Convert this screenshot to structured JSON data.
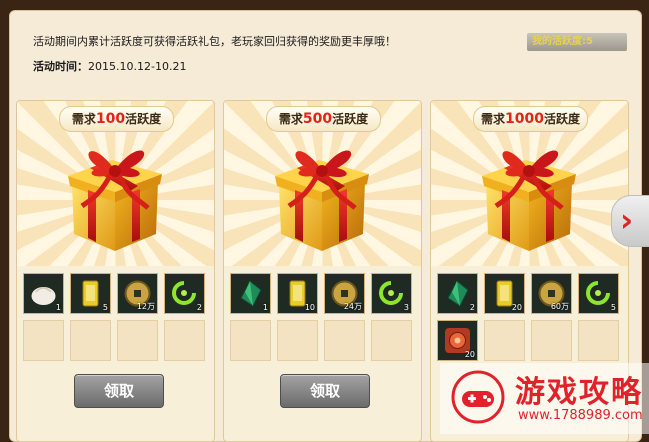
{
  "header": {
    "description": "活动期间内累计活跃度可获得活跃礼包，老玩家回归获得的奖励更丰厚哦！",
    "time_label": "活动时间：",
    "time_value": "2015.10.12-10.21",
    "my_activity": "我的活跃度:5"
  },
  "cards": [
    {
      "req_prefix": "需求",
      "req_value": "100",
      "req_suffix": "活跃度",
      "items": [
        {
          "icon": "bun-icon",
          "count": "1"
        },
        {
          "icon": "gold-token-icon",
          "count": "5"
        },
        {
          "icon": "coin-icon",
          "count": "12万"
        },
        {
          "icon": "green-symbol-icon",
          "count": "2"
        }
      ],
      "button": "领取"
    },
    {
      "req_prefix": "需求",
      "req_value": "500",
      "req_suffix": "活跃度",
      "items": [
        {
          "icon": "green-crystal-icon",
          "count": "1"
        },
        {
          "icon": "gold-token-icon",
          "count": "10"
        },
        {
          "icon": "coin-icon",
          "count": "24万"
        },
        {
          "icon": "green-symbol-icon",
          "count": "3"
        }
      ],
      "button": "领取"
    },
    {
      "req_prefix": "需求",
      "req_value": "1000",
      "req_suffix": "活跃度",
      "items": [
        {
          "icon": "green-crystal-icon",
          "count": "2"
        },
        {
          "icon": "gold-token-icon",
          "count": "20"
        },
        {
          "icon": "coin-icon",
          "count": "60万"
        },
        {
          "icon": "green-symbol-icon",
          "count": "5"
        },
        {
          "icon": "red-badge-icon",
          "count": "20"
        }
      ]
    }
  ],
  "watermark": {
    "title": "游戏攻略",
    "url": "www.1788989.com"
  },
  "colors": {
    "accent": "#e0231b",
    "panel": "#f5ebd6"
  }
}
